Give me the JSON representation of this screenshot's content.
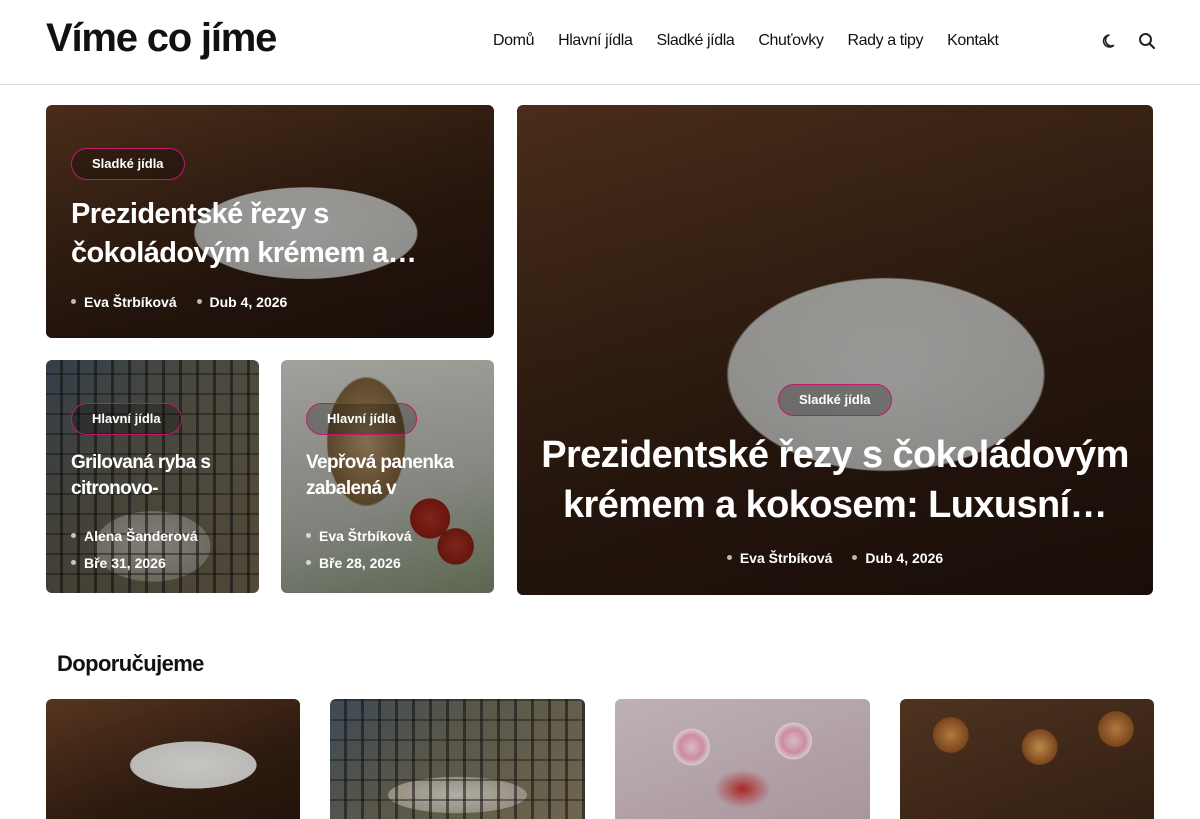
{
  "site": {
    "logo": "Víme co jíme"
  },
  "nav": {
    "items": [
      "Domů",
      "Hlavní jídla",
      "Sladké jídla",
      "Chuťovky",
      "Rady a tipy",
      "Kontakt"
    ]
  },
  "header_icons": [
    "moon-icon",
    "search-icon"
  ],
  "featured": [
    {
      "category": "Sladké jídla",
      "title": "Prezidentské řezy s čokoládovým krémem a…",
      "author": "Eva Štrbíková",
      "date": "Dub 4, 2026"
    },
    {
      "category": "Hlavní jídla",
      "title": "Grilovaná ryba s citronovo-",
      "author": "Alena Šanderová",
      "date": "Bře 31, 2026"
    },
    {
      "category": "Hlavní jídla",
      "title": "Vepřová panenka zabalená v",
      "author": "Eva Štrbíková",
      "date": "Bře 28, 2026"
    }
  ],
  "hero": {
    "category": "Sladké jídla",
    "title": "Prezidentské řezy s čokoládovým krémem a kokosem: Luxusní…",
    "author": "Eva Štrbíková",
    "date": "Dub 4, 2026"
  },
  "recommended": {
    "title": "Doporučujeme"
  },
  "colors": {
    "accent": "#c2186b",
    "text": "#111111",
    "divider": "#d9d9d9"
  }
}
